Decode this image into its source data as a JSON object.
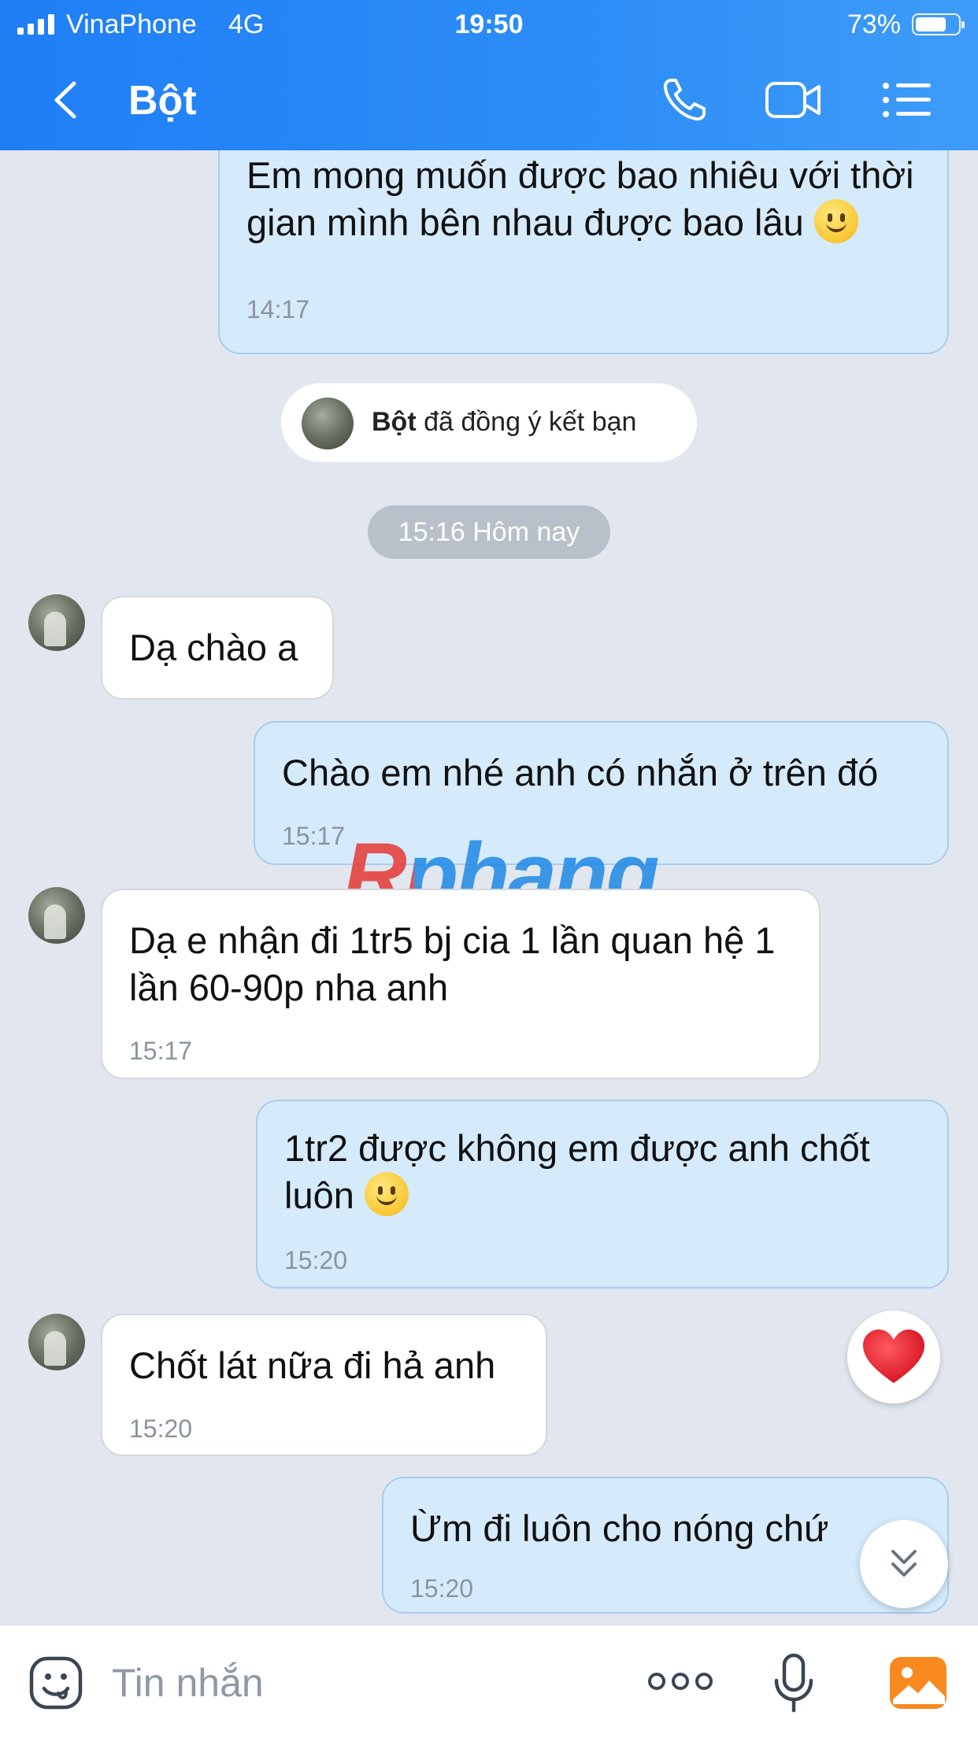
{
  "status_bar": {
    "carrier": "VinaPhone",
    "network": "4G",
    "time": "19:50",
    "battery": "73%",
    "battery_level": 0.73
  },
  "header": {
    "title": "Bột",
    "icons": [
      "back-icon",
      "phone-icon",
      "video-icon",
      "menu-icon"
    ]
  },
  "messages": [
    {
      "dir": "out",
      "text": "Em mong muốn được bao nhiêu với thời gian mình bên nhau được bao lâu",
      "emoji": true,
      "time": "14:17"
    },
    {
      "dir": "in",
      "text": "Dạ chào a",
      "time": ""
    },
    {
      "dir": "out",
      "text": "Chào em nhé anh có nhắn ở trên đó",
      "time": "15:17"
    },
    {
      "dir": "in",
      "text": "Dạ e nhận đi 1tr5 bj cia 1 lần quan hệ 1 lần 60-90p nha anh",
      "time": "15:17"
    },
    {
      "dir": "out",
      "text": "1tr2 được không em được anh chốt luôn",
      "emoji": true,
      "time": "15:20"
    },
    {
      "dir": "in",
      "text": "Chốt lát nữa đi hả anh",
      "time": "15:20"
    },
    {
      "dir": "out",
      "text": "Ừm đi luôn cho nóng chứ",
      "time": "15:20"
    }
  ],
  "system": {
    "friend_name": "Bột",
    "friend_text": " đã đồng ý kết bạn",
    "date_separator": "15:16 Hôm nay"
  },
  "reaction": "heart-icon",
  "watermark": "Rphang",
  "input": {
    "placeholder": "Tin nhắn",
    "icons": [
      "sticker-icon",
      "more-icon",
      "mic-icon",
      "image-icon"
    ]
  },
  "colors": {
    "header": "#2d8df7",
    "bubble_out": "#d5ebfc",
    "bubble_in": "#ffffff",
    "chat_background": "#e2e7ef"
  }
}
